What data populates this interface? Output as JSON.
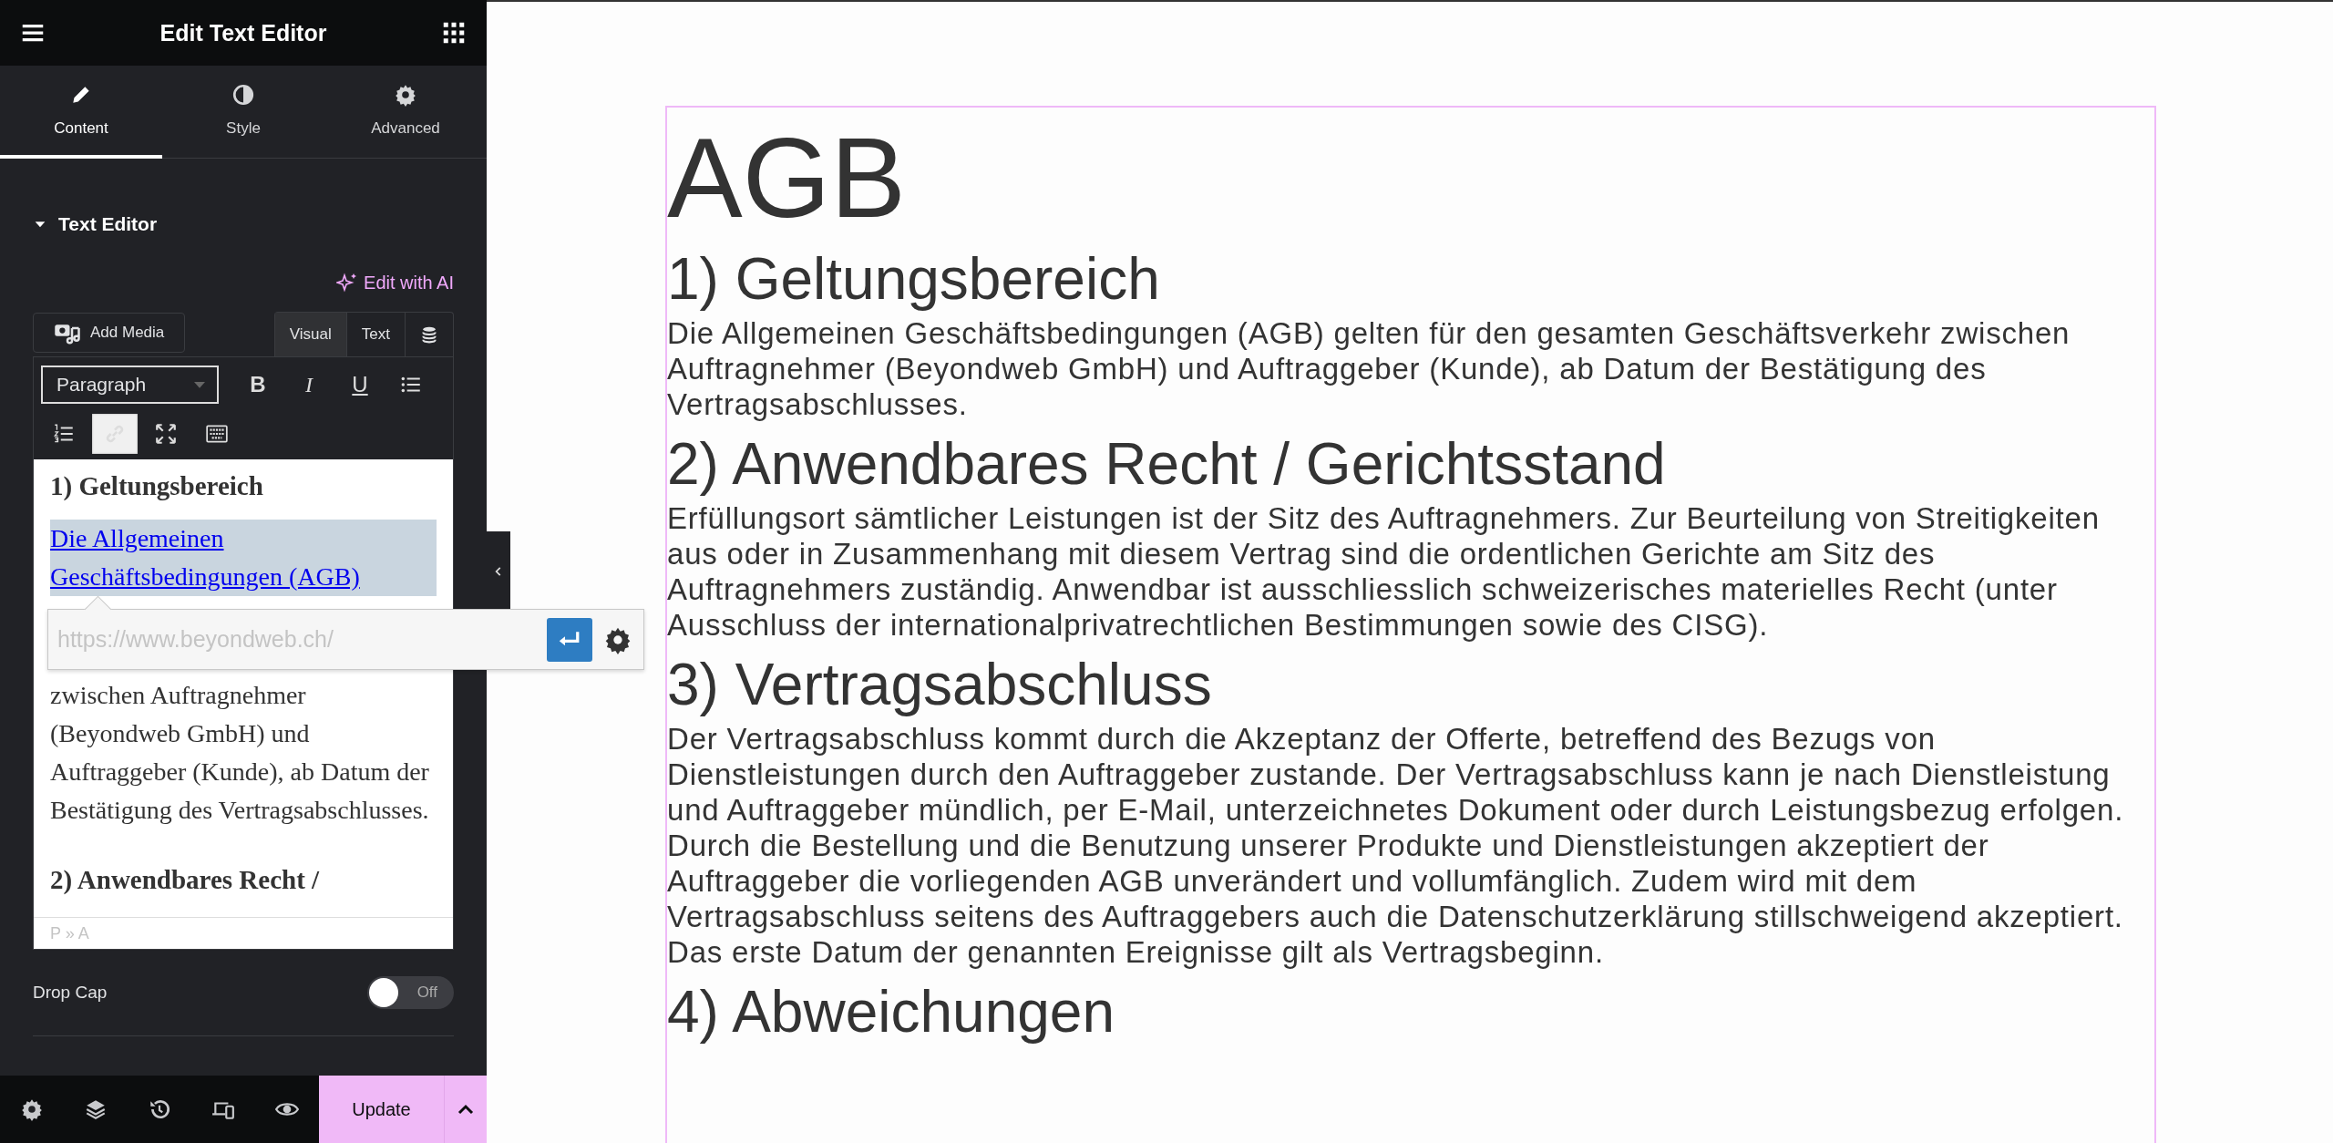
{
  "panel": {
    "title": "Edit Text Editor",
    "tabs": [
      {
        "label": "Content",
        "kind": "pencil",
        "selected": true
      },
      {
        "label": "Style",
        "kind": "contrast",
        "selected": false
      },
      {
        "label": "Advanced",
        "kind": "gear",
        "selected": false
      }
    ],
    "section": {
      "title": "Text Editor",
      "expanded": true
    },
    "ai_link": "Edit with AI",
    "add_media": "Add Media",
    "mode_tabs": [
      {
        "label": "Visual",
        "selected": true
      },
      {
        "label": "Text",
        "selected": false
      }
    ],
    "format_select": "Paragraph",
    "toolbar": [
      {
        "kind": "bold",
        "label": "B",
        "selected": false
      },
      {
        "kind": "italic",
        "label": "I",
        "selected": false
      },
      {
        "kind": "underline",
        "label": "U",
        "selected": false
      },
      {
        "kind": "bullets",
        "selected": false
      },
      {
        "kind": "numbers",
        "selected": false
      },
      {
        "kind": "link",
        "selected": true
      },
      {
        "kind": "fullscreen",
        "selected": false
      },
      {
        "kind": "keyboard",
        "selected": false
      }
    ],
    "editor": {
      "blocks": [
        {
          "kind": "heading",
          "text": "1) Geltungsbereich"
        },
        {
          "kind": "link",
          "text": "Die Allgemeinen Geschäftsbedingungen (AGB)"
        },
        {
          "kind": "paragraph",
          "text": "zwischen Auftragnehmer (Beyondweb GmbH) und Auftraggeber (Kunde), ab Datum der Bestätigung des Vertragsabschlusses."
        },
        {
          "kind": "heading",
          "text": "2) Anwendbares Recht /"
        }
      ],
      "path": "P » A"
    },
    "link_popup": {
      "placeholder": "https://www.beyondweb.ch/"
    },
    "drop_cap": {
      "label": "Drop Cap",
      "on": false,
      "state_text": "Off"
    },
    "footer": {
      "icons": [
        {
          "kind": "gear"
        },
        {
          "kind": "layers"
        },
        {
          "kind": "history"
        },
        {
          "kind": "devices"
        },
        {
          "kind": "eye"
        }
      ],
      "update": "Update"
    }
  },
  "page": {
    "title": "AGB",
    "sections": [
      {
        "heading": "1) Geltungsbereich",
        "text": "Die Allgemeinen Geschäftsbedingungen (AGB) gelten für den gesamten Geschäftsverkehr zwischen Auftragnehmer (Beyondweb GmbH) und Auftraggeber (Kunde), ab Datum der Bestätigung des Vertragsabschlusses."
      },
      {
        "heading": "2) Anwendbares Recht / Gerichtsstand",
        "text": "Erfüllungsort sämtlicher Leistungen ist der Sitz des Auftragnehmers. Zur Beurteilung von Streitigkeiten aus oder in Zusammenhang mit diesem Vertrag sind die ordentlichen Gerichte am Sitz des Auftragnehmers zuständig. Anwendbar ist ausschliesslich schweizerisches materielles Recht (unter Ausschluss der internationalprivatrechtlichen Bestimmungen sowie des CISG)."
      },
      {
        "heading": "3) Vertragsabschluss",
        "text": "Der Vertragsabschluss kommt durch die Akzeptanz der Offerte, betreffend des Bezugs von Dienstleistungen durch den Auftraggeber zustande. Der Vertragsabschluss kann je nach Dienstleistung und Auftraggeber mündlich, per E-Mail, unterzeichnetes Dokument oder durch Leistungsbezug erfolgen. Durch die Bestellung und die Benutzung unserer Produkte und Dienstleistungen akzeptiert der Auftraggeber die vorliegenden AGB unverändert und vollumfänglich. Zudem wird mit dem Vertragsabschluss seitens des Auftraggebers auch die Datenschutzerklärung stillschweigend akzeptiert. Das erste Datum der genannten Ereignisse gilt als Vertragsbeginn."
      },
      {
        "heading": "4) Abweichungen"
      }
    ]
  }
}
